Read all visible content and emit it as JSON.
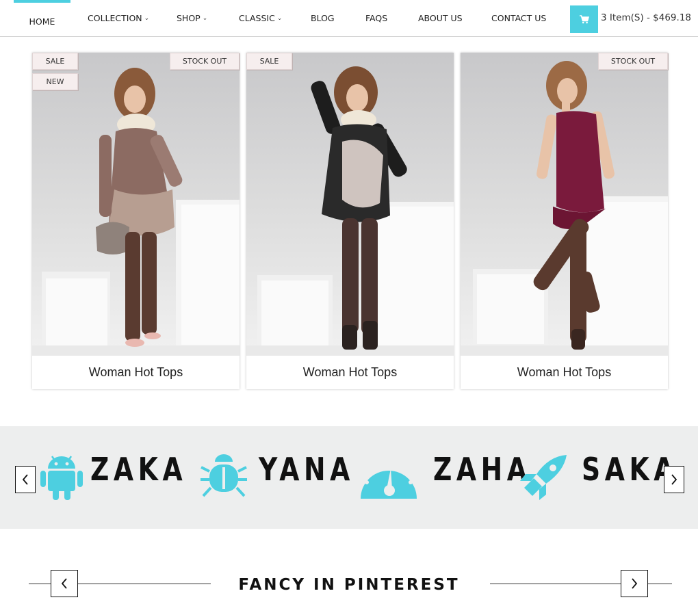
{
  "nav": {
    "items": [
      {
        "label": "HOME",
        "has_dropdown": false,
        "active": true
      },
      {
        "label": "COLLECTION",
        "has_dropdown": true
      },
      {
        "label": "SHOP",
        "has_dropdown": true
      },
      {
        "label": "CLASSIC",
        "has_dropdown": true
      },
      {
        "label": "BLOG",
        "has_dropdown": false
      },
      {
        "label": "FAQS",
        "has_dropdown": false
      },
      {
        "label": "ABOUT US",
        "has_dropdown": false
      },
      {
        "label": "CONTACT US",
        "has_dropdown": false
      }
    ],
    "cart_summary": "3 Item(S) - $469.18",
    "cart_icon": "shopping-cart-icon"
  },
  "products": [
    {
      "title": "Woman Hot Tops",
      "badges": [
        "SALE",
        "NEW"
      ],
      "stock_badge": "STOCK OUT",
      "dress": "paisley"
    },
    {
      "title": "Woman Hot Tops",
      "badges": [
        "SALE"
      ],
      "stock_badge": "",
      "dress": "black-print"
    },
    {
      "title": "Woman Hot Tops",
      "badges": [],
      "stock_badge": "STOCK OUT",
      "dress": "burgundy"
    }
  ],
  "brands": [
    {
      "name": "ZAKA",
      "icon": "android-icon"
    },
    {
      "name": "YANA",
      "icon": "bug-icon"
    },
    {
      "name": "ZAHA",
      "icon": "speedometer-icon"
    },
    {
      "name": "SAKA",
      "icon": "rocket-icon"
    }
  ],
  "pinterest": {
    "title": "FANCY IN PINTEREST"
  },
  "colors": {
    "accent": "#4dcfe0",
    "brand_strip_bg": "#edeeee"
  }
}
